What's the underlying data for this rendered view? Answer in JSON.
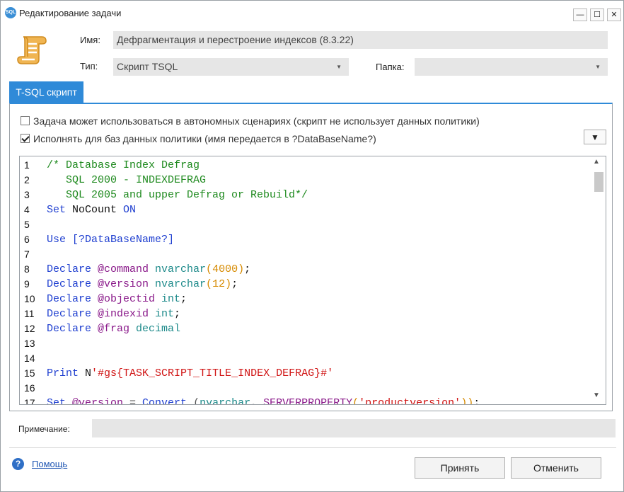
{
  "window": {
    "title": "Редактирование задачи",
    "icon_text": "SQL",
    "controls": [
      "—",
      "☐",
      "✕"
    ]
  },
  "form": {
    "name_label": "Имя:",
    "name_value": "Дефрагментация и перестроение индексов (8.3.22)",
    "type_label": "Тип:",
    "type_value": "Скрипт TSQL",
    "folder_label": "Папка:",
    "folder_value": ""
  },
  "tab": {
    "label": "T-SQL скрипт"
  },
  "options": {
    "autonomous_label": "Задача может использоваться в автономных сценариях (скрипт не использует данных политики)",
    "autonomous_checked": false,
    "per_db_label": "Исполнять для баз данных политики (имя передается в ?DataBaseName?)",
    "per_db_checked": true,
    "menu_glyph": "▼"
  },
  "editor": {
    "line_numbers": [
      "1",
      "2",
      "3",
      "4",
      "5",
      "6",
      "7",
      "8",
      "9",
      "10",
      "11",
      "12",
      "13",
      "14",
      "15",
      "16",
      "17"
    ],
    "lines": [
      [
        {
          "t": "/* Database Index Defrag",
          "c": "comment"
        }
      ],
      [
        {
          "t": "   SQL 2000 - INDEXDEFRAG",
          "c": "comment"
        }
      ],
      [
        {
          "t": "   SQL 2005 and upper Defrag or Rebuild*/",
          "c": "comment"
        }
      ],
      [
        {
          "t": "Set",
          "c": "kw"
        },
        {
          "t": " NoCount ",
          "c": "plain"
        },
        {
          "t": "ON",
          "c": "kw"
        }
      ],
      [],
      [
        {
          "t": "Use [?DataBaseName?]",
          "c": "kw"
        }
      ],
      [],
      [
        {
          "t": "Declare ",
          "c": "kw"
        },
        {
          "t": "@command",
          "c": "var"
        },
        {
          "t": " nvarchar",
          "c": "type"
        },
        {
          "t": "(",
          "c": "num"
        },
        {
          "t": "4000",
          "c": "num"
        },
        {
          "t": ")",
          "c": "num"
        },
        {
          "t": ";",
          "c": "plain"
        }
      ],
      [
        {
          "t": "Declare ",
          "c": "kw"
        },
        {
          "t": "@version",
          "c": "var"
        },
        {
          "t": " nvarchar",
          "c": "type"
        },
        {
          "t": "(",
          "c": "num"
        },
        {
          "t": "12",
          "c": "num"
        },
        {
          "t": ")",
          "c": "num"
        },
        {
          "t": ";",
          "c": "plain"
        }
      ],
      [
        {
          "t": "Declare ",
          "c": "kw"
        },
        {
          "t": "@objectid",
          "c": "var"
        },
        {
          "t": " int",
          "c": "type"
        },
        {
          "t": ";",
          "c": "plain"
        }
      ],
      [
        {
          "t": "Declare ",
          "c": "kw"
        },
        {
          "t": "@indexid",
          "c": "var"
        },
        {
          "t": " int",
          "c": "type"
        },
        {
          "t": ";",
          "c": "plain"
        }
      ],
      [
        {
          "t": "Declare ",
          "c": "kw"
        },
        {
          "t": "@frag",
          "c": "var"
        },
        {
          "t": " decimal",
          "c": "type"
        }
      ],
      [],
      [],
      [
        {
          "t": "Print",
          "c": "kw"
        },
        {
          "t": " N",
          "c": "plain"
        },
        {
          "t": "'#gs{TASK_SCRIPT_TITLE_INDEX_DEFRAG}#'",
          "c": "str"
        }
      ],
      [],
      [
        {
          "t": "Set ",
          "c": "kw"
        },
        {
          "t": "@version",
          "c": "var"
        },
        {
          "t": " = ",
          "c": "op"
        },
        {
          "t": "Convert",
          "c": "kw"
        },
        {
          "t": " (",
          "c": "op"
        },
        {
          "t": "nvarchar",
          "c": "type"
        },
        {
          "t": ", ",
          "c": "op"
        },
        {
          "t": "SERVERPROPERTY",
          "c": "fn"
        },
        {
          "t": "(",
          "c": "num"
        },
        {
          "t": "'productversion'",
          "c": "str"
        },
        {
          "t": "))",
          "c": "num"
        },
        {
          "t": ";",
          "c": "plain"
        }
      ]
    ]
  },
  "note": {
    "label": "Примечание:",
    "value": ""
  },
  "footer": {
    "help_icon": "?",
    "help_label": "Помощь",
    "accept_label": "Принять",
    "cancel_label": "Отменить"
  }
}
